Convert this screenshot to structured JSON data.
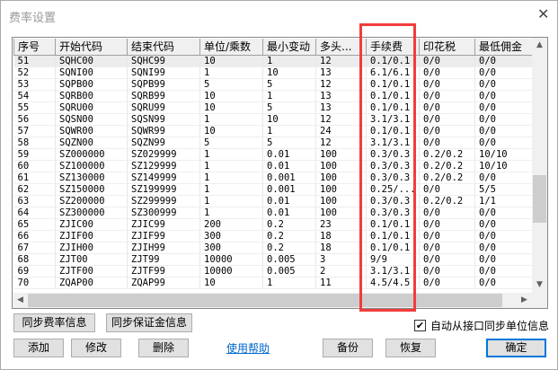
{
  "window": {
    "title": "费率设置",
    "close": "✕"
  },
  "table": {
    "headers": [
      "序号",
      "开始代码",
      "结束代码",
      "单位/乘数",
      "最小变动",
      "多头...",
      "手续费",
      "印花税",
      "最低佣金"
    ],
    "rows": [
      [
        "51",
        "SQHC00",
        "SQHC99",
        "10",
        "1",
        "12",
        "0.1/0.1",
        "0/0",
        "0/0"
      ],
      [
        "52",
        "SQNI00",
        "SQNI99",
        "1",
        "10",
        "13",
        "6.1/6.1",
        "0/0",
        "0/0"
      ],
      [
        "53",
        "SQPB00",
        "SQPB99",
        "5",
        "5",
        "12",
        "0.1/0.1",
        "0/0",
        "0/0"
      ],
      [
        "54",
        "SQRB00",
        "SQRB99",
        "10",
        "1",
        "13",
        "0.1/0.1",
        "0/0",
        "0/0"
      ],
      [
        "55",
        "SQRU00",
        "SQRU99",
        "10",
        "5",
        "13",
        "0.1/0.1",
        "0/0",
        "0/0"
      ],
      [
        "56",
        "SQSN00",
        "SQSN99",
        "1",
        "10",
        "12",
        "3.1/3.1",
        "0/0",
        "0/0"
      ],
      [
        "57",
        "SQWR00",
        "SQWR99",
        "10",
        "1",
        "24",
        "0.1/0.1",
        "0/0",
        "0/0"
      ],
      [
        "58",
        "SQZN00",
        "SQZN99",
        "5",
        "5",
        "12",
        "3.1/3.1",
        "0/0",
        "0/0"
      ],
      [
        "59",
        "SZ000000",
        "SZ029999",
        "1",
        "0.01",
        "100",
        "0.3/0.3",
        "0.2/0.2",
        "10/10"
      ],
      [
        "60",
        "SZ100000",
        "SZ129999",
        "1",
        "0.01",
        "100",
        "0.3/0.3",
        "0.2/0.2",
        "10/10"
      ],
      [
        "61",
        "SZ130000",
        "SZ149999",
        "1",
        "0.001",
        "100",
        "0.3/0.3",
        "0.2/0.2",
        "0/0"
      ],
      [
        "62",
        "SZ150000",
        "SZ199999",
        "1",
        "0.001",
        "100",
        "0.25/...",
        "0/0",
        "5/5"
      ],
      [
        "63",
        "SZ200000",
        "SZ299999",
        "1",
        "0.01",
        "100",
        "0.3/0.3",
        "0.2/0.2",
        "1/1"
      ],
      [
        "64",
        "SZ300000",
        "SZ300999",
        "1",
        "0.01",
        "100",
        "0.3/0.3",
        "0/0",
        "0/0"
      ],
      [
        "65",
        "ZJIC00",
        "ZJIC99",
        "200",
        "0.2",
        "23",
        "0.1/0.1",
        "0/0",
        "0/0"
      ],
      [
        "66",
        "ZJIF00",
        "ZJIF99",
        "300",
        "0.2",
        "18",
        "0.1/0.1",
        "0/0",
        "0/0"
      ],
      [
        "67",
        "ZJIH00",
        "ZJIH99",
        "300",
        "0.2",
        "18",
        "0.1/0.1",
        "0/0",
        "0/0"
      ],
      [
        "68",
        "ZJT00",
        "ZJT99",
        "10000",
        "0.005",
        "3",
        "9/9",
        "0/0",
        "0/0"
      ],
      [
        "69",
        "ZJTF00",
        "ZJTF99",
        "10000",
        "0.005",
        "2",
        "3.1/3.1",
        "0/0",
        "0/0"
      ],
      [
        "70",
        "ZQAP00",
        "ZQAP99",
        "10",
        "1",
        "11",
        "4.5/4.5",
        "0/0",
        "0/0"
      ]
    ]
  },
  "buttons": {
    "sync_fee": "同步费率信息",
    "sync_margin": "同步保证金信息",
    "add": "添加",
    "edit": "修改",
    "delete": "删除",
    "help": "使用帮助",
    "backup": "备份",
    "restore": "恢复",
    "ok": "确定"
  },
  "auto_sync": {
    "label": "自动从接口同步单位信息",
    "checked": true,
    "mark": "✔"
  }
}
